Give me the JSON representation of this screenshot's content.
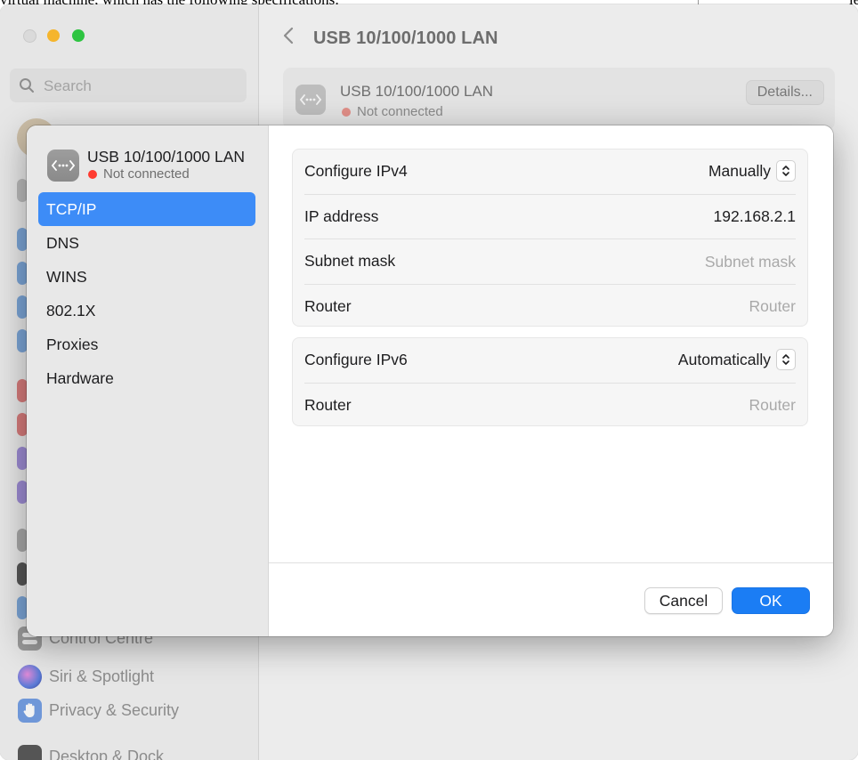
{
  "background_doc": {
    "text": "virtual machine, which has the following specifications:",
    "right_text": "le"
  },
  "window": {
    "search_placeholder": "Search",
    "header_title": "USB 10/100/1000 LAN",
    "card": {
      "name": "USB 10/100/1000 LAN",
      "status": "Not connected",
      "details_label": "Details..."
    },
    "sidebar_items": [
      {
        "label": "Control Centre",
        "icon": "control-centre-icon"
      },
      {
        "label": "Siri & Spotlight",
        "icon": "siri-icon"
      },
      {
        "label": "Privacy & Security",
        "icon": "hand-icon"
      },
      {
        "label": "Desktop & Dock",
        "icon": "desktop-dock-icon"
      }
    ]
  },
  "sheet": {
    "interface_name": "USB 10/100/1000 LAN",
    "status": "Not connected",
    "nav": [
      "TCP/IP",
      "DNS",
      "WINS",
      "802.1X",
      "Proxies",
      "Hardware"
    ],
    "active_nav": "TCP/IP",
    "ipv4": {
      "configure_label": "Configure IPv4",
      "configure_value": "Manually",
      "ip_label": "IP address",
      "ip_value": "192.168.2.1",
      "subnet_label": "Subnet mask",
      "subnet_placeholder": "Subnet mask",
      "router_label": "Router",
      "router_placeholder": "Router"
    },
    "ipv6": {
      "configure_label": "Configure IPv6",
      "configure_value": "Automatically",
      "router_label": "Router",
      "router_value": "Router"
    },
    "cancel_label": "Cancel",
    "ok_label": "OK"
  },
  "colors": {
    "accent": "#1b7df4",
    "selection": "#3d8cf7",
    "status_red": "#ff3b30"
  }
}
